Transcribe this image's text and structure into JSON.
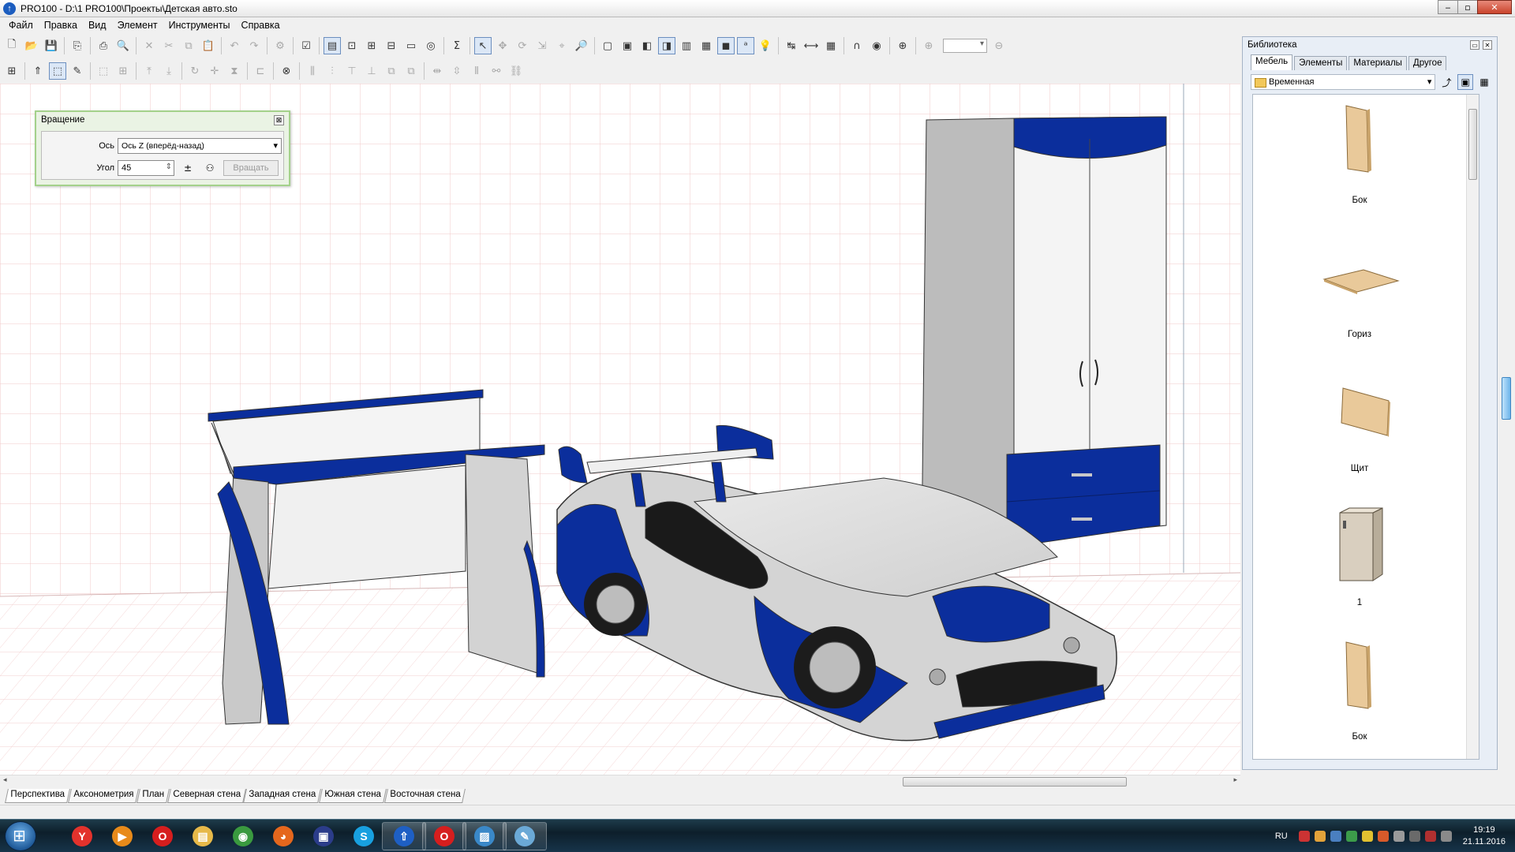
{
  "window": {
    "app_icon": "pro100-arrow-icon",
    "title": "PRO100 - D:\\1 PRO100\\Проекты\\Детская авто.sto",
    "buttons": {
      "minimize": "‒",
      "maximize": "▫",
      "close": "✕"
    }
  },
  "menu": [
    "Файл",
    "Правка",
    "Вид",
    "Элемент",
    "Инструменты",
    "Справка"
  ],
  "toolbar1": [
    {
      "icon": "new-file-icon",
      "glyph": "🗋"
    },
    {
      "icon": "open-folder-icon",
      "glyph": "📂"
    },
    {
      "icon": "save-icon",
      "glyph": "💾"
    },
    {
      "sep": true
    },
    {
      "icon": "export-icon",
      "glyph": "⎘"
    },
    {
      "sep": true
    },
    {
      "icon": "print-icon",
      "glyph": "⎙"
    },
    {
      "icon": "print-preview-icon",
      "glyph": "🔍"
    },
    {
      "sep": true
    },
    {
      "icon": "delete-icon",
      "glyph": "✕",
      "dim": true
    },
    {
      "icon": "cut-icon",
      "glyph": "✂",
      "dim": true
    },
    {
      "icon": "copy-icon",
      "glyph": "⧉",
      "dim": true
    },
    {
      "icon": "paste-icon",
      "glyph": "📋",
      "dim": true
    },
    {
      "sep": true
    },
    {
      "icon": "undo-icon",
      "glyph": "↶",
      "dim": true
    },
    {
      "icon": "redo-icon",
      "glyph": "↷",
      "dim": true
    },
    {
      "sep": true
    },
    {
      "icon": "properties-icon",
      "glyph": "⚙",
      "dim": true
    },
    {
      "sep": true
    },
    {
      "icon": "checklist-icon",
      "glyph": "☑"
    },
    {
      "sep": true
    },
    {
      "icon": "view-layout-icon",
      "glyph": "▤",
      "active": true
    },
    {
      "icon": "zoom-fit-icon",
      "glyph": "⊡"
    },
    {
      "icon": "zoom-select-icon",
      "glyph": "⊞"
    },
    {
      "icon": "zoom-window-icon",
      "glyph": "⊟"
    },
    {
      "icon": "screen-icon",
      "glyph": "▭"
    },
    {
      "icon": "render-icon",
      "glyph": "◎"
    },
    {
      "sep": true
    },
    {
      "icon": "sum-icon",
      "glyph": "Σ"
    },
    {
      "sep": true
    },
    {
      "icon": "pointer-icon",
      "glyph": "↖",
      "active": true
    },
    {
      "icon": "move-icon",
      "glyph": "✥",
      "dim": true
    },
    {
      "icon": "rotate-3d-icon",
      "glyph": "⟳",
      "dim": true
    },
    {
      "icon": "resize-icon",
      "glyph": "⇲",
      "dim": true
    },
    {
      "icon": "edit-points-icon",
      "glyph": "⌖",
      "dim": true
    },
    {
      "icon": "zoom-tool-icon",
      "glyph": "🔎",
      "dim": true
    },
    {
      "sep": true
    },
    {
      "icon": "wireframe-icon",
      "glyph": "▢"
    },
    {
      "icon": "hidden-lines-icon",
      "glyph": "▣"
    },
    {
      "icon": "shaded-icon",
      "glyph": "◧"
    },
    {
      "icon": "shaded-edges-icon",
      "glyph": "◨",
      "active": true
    },
    {
      "icon": "texture-icon",
      "glyph": "▥"
    },
    {
      "icon": "texture-edges-icon",
      "glyph": "▦"
    },
    {
      "icon": "realistic-icon",
      "glyph": "◼",
      "active": true
    },
    {
      "icon": "labels-icon",
      "glyph": "ᵃ",
      "active": true
    },
    {
      "icon": "light-bulb-icon",
      "glyph": "💡"
    },
    {
      "sep": true
    },
    {
      "icon": "dimension-icon",
      "glyph": "↹"
    },
    {
      "icon": "measure-icon",
      "glyph": "⟷"
    },
    {
      "icon": "grid-icon",
      "glyph": "▦"
    },
    {
      "sep": true
    },
    {
      "icon": "magnet-icon",
      "glyph": "∩"
    },
    {
      "icon": "sphere-icon",
      "glyph": "◉"
    },
    {
      "sep": true
    },
    {
      "icon": "target-icon",
      "glyph": "⊕"
    },
    {
      "sep": true
    },
    {
      "icon": "zoom-in-icon",
      "glyph": "⊕",
      "dim": true
    },
    {
      "zoom": true
    },
    {
      "icon": "zoom-out-icon",
      "glyph": "⊖",
      "dim": true
    }
  ],
  "toolbar2": [
    {
      "icon": "group-icon",
      "glyph": "⊞"
    },
    {
      "sep": true
    },
    {
      "icon": "align-up-icon",
      "glyph": "⇑"
    },
    {
      "icon": "select-box-icon",
      "glyph": "⬚",
      "active": true
    },
    {
      "icon": "pencil-icon",
      "glyph": "✎"
    },
    {
      "sep": true
    },
    {
      "icon": "frame-icon",
      "glyph": "⬚",
      "dim": true
    },
    {
      "icon": "frame-split-icon",
      "glyph": "⊞",
      "dim": true
    },
    {
      "sep": true
    },
    {
      "icon": "raise-icon",
      "glyph": "⤒",
      "dim": true
    },
    {
      "icon": "lower-icon",
      "glyph": "⤓",
      "dim": true
    },
    {
      "sep": true
    },
    {
      "icon": "rotate-icon",
      "glyph": "↻",
      "dim": true
    },
    {
      "icon": "move-cross-icon",
      "glyph": "✛",
      "dim": true
    },
    {
      "icon": "mirror-icon",
      "glyph": "⧗",
      "dim": true
    },
    {
      "sep": true
    },
    {
      "icon": "align-left-icon",
      "glyph": "⊏",
      "dim": true
    },
    {
      "sep": true
    },
    {
      "icon": "target-small-icon",
      "glyph": "⊗"
    },
    {
      "sep": true
    },
    {
      "icon": "dist-h-icon",
      "glyph": "⫼",
      "dim": true
    },
    {
      "icon": "dist-v-icon",
      "glyph": "⫶",
      "dim": true
    },
    {
      "icon": "align-top-icon",
      "glyph": "⊤",
      "dim": true
    },
    {
      "icon": "align-bottom-icon",
      "glyph": "⊥",
      "dim": true
    },
    {
      "icon": "stack-icon",
      "glyph": "⧉",
      "dim": true
    },
    {
      "icon": "stack2-icon",
      "glyph": "⧉",
      "dim": true
    },
    {
      "sep": true
    },
    {
      "icon": "space-h-icon",
      "glyph": "⇹",
      "dim": true
    },
    {
      "icon": "space-v-icon",
      "glyph": "⇳",
      "dim": true
    },
    {
      "icon": "equalize-icon",
      "glyph": "⫴",
      "dim": true
    },
    {
      "icon": "link-icon",
      "glyph": "⚯",
      "dim": true
    },
    {
      "icon": "chain-icon",
      "glyph": "⛓",
      "dim": true
    }
  ],
  "rotate_dialog": {
    "title": "Вращение",
    "close_glyph": "⊠",
    "axis_label": "Ось",
    "axis_value": "Ось Z (вперёд-назад)",
    "angle_label": "Угол",
    "angle_value": "45",
    "sign_icon": "plus-minus-icon",
    "sign_glyph": "±",
    "each_icon": "each-element-icon",
    "each_glyph": "⚇",
    "rotate_button": "Вращать"
  },
  "view_tabs": [
    "Перспектива",
    "Аксонометрия",
    "План",
    "Северная стена",
    "Западная стена",
    "Южная стена",
    "Восточная стена"
  ],
  "active_view_tab": 0,
  "library": {
    "title": "Библиотека",
    "tabs": [
      "Мебель",
      "Элементы",
      "Материалы",
      "Другое"
    ],
    "active_tab": 0,
    "folder": "Временная",
    "items": [
      {
        "label": "Бок",
        "shape": "side-panel"
      },
      {
        "label": "Гориз",
        "shape": "horizontal-shelf"
      },
      {
        "label": "Щит",
        "shape": "board"
      },
      {
        "label": "1",
        "shape": "cabinet"
      },
      {
        "label": "Бок",
        "shape": "side-panel"
      }
    ]
  },
  "colors": {
    "accent_blue": "#0b2e9c",
    "panel_white": "#f7f7f7",
    "panel_grey": "#c9c9c9",
    "wood": "#e9c99a",
    "grid_line": "#f2c8c8"
  },
  "taskbar": {
    "apps": [
      {
        "name": "yandex-browser",
        "glyph": "Y",
        "color": "#e3322c",
        "open": false
      },
      {
        "name": "media-player",
        "glyph": "▶",
        "color": "#e88a1a",
        "open": false
      },
      {
        "name": "opera",
        "glyph": "O",
        "color": "#d61e1e",
        "open": false
      },
      {
        "name": "file-explorer",
        "glyph": "▤",
        "color": "#e7b949",
        "open": false
      },
      {
        "name": "chrome",
        "glyph": "◉",
        "color": "#3a9a3f",
        "open": false
      },
      {
        "name": "firefox",
        "glyph": "◕",
        "color": "#e5671d",
        "open": false
      },
      {
        "name": "save-app",
        "glyph": "▣",
        "color": "#2b3c8a",
        "open": false
      },
      {
        "name": "skype",
        "glyph": "S",
        "color": "#18a0e0",
        "open": false
      },
      {
        "name": "pro100",
        "glyph": "⇧",
        "color": "#1e5fc4",
        "open": true
      },
      {
        "name": "opera-2",
        "glyph": "O",
        "color": "#d61e1e",
        "open": true
      },
      {
        "name": "image-viewer",
        "glyph": "▨",
        "color": "#3a88c8",
        "open": true
      },
      {
        "name": "paint",
        "glyph": "✎",
        "color": "#6ba9d6",
        "open": true
      }
    ],
    "lang": "RU",
    "time": "19:19",
    "date": "21.11.2016"
  }
}
